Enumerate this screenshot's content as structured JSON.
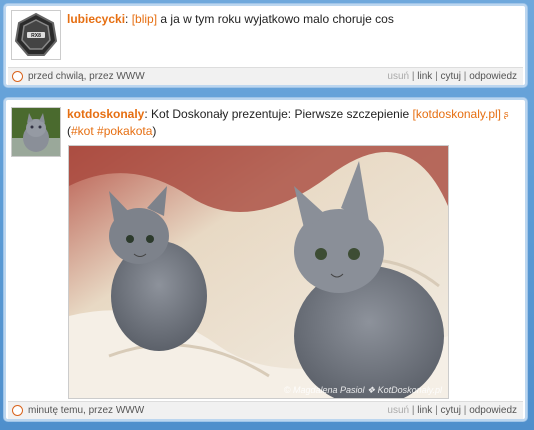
{
  "posts": [
    {
      "username": "lubiecycki",
      "separator": ":",
      "prefix_tag": "[blip]",
      "text": " a ja w tym roku wyjatkowo malo choruje cos",
      "time": "przed chwilą, przez WWW",
      "actions": {
        "delete": "usuń",
        "link": "link",
        "quote": "cytuj",
        "reply": "odpowiedz"
      }
    },
    {
      "username": "kotdoskonaly",
      "separator": ":",
      "text": " Kot Doskonały prezentuje: Pierwsze szczepienie ",
      "link_text": "[kotdoskonaly.pl]",
      "link_icon": "external-feed-icon",
      "tags_open": "(",
      "tag1": "#kot",
      "tag2": "#pokakota",
      "tags_close": ")",
      "photo_watermark": "© Magdalena Pasiol ❖ KotDoskonały.pl",
      "time": "minutę temu, przez WWW",
      "actions": {
        "delete": "usuń",
        "link": "link",
        "quote": "cytuj",
        "reply": "odpowiedz"
      }
    }
  ],
  "colors": {
    "accent": "#e66f12",
    "frame": "#5b9bd5",
    "card_border": "#9fc4e8"
  }
}
